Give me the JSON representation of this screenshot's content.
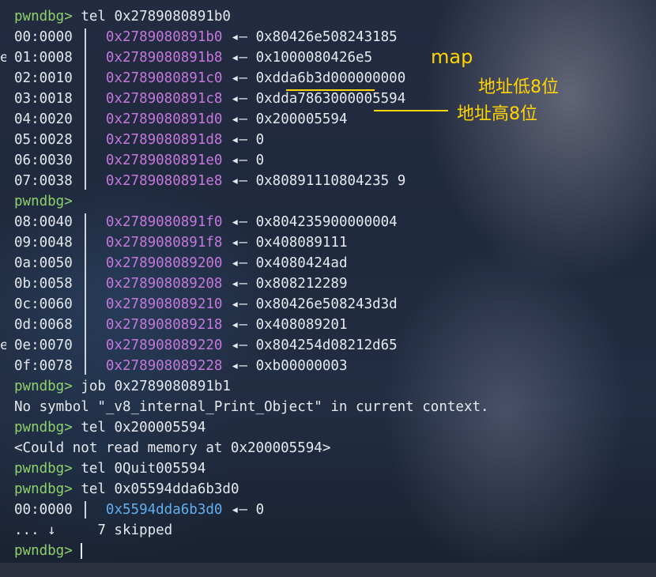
{
  "prompt": "pwndbg>",
  "commands": {
    "tel1": "tel 0x2789080891b0",
    "job": "job 0x2789080891b1",
    "tel2": "tel 0x200005594",
    "tel3": "tel 0Quit005594",
    "tel4": "tel 0x05594dda6b3d0"
  },
  "rows": [
    {
      "idx": "00:0000",
      "addr": "0x2789080891b0",
      "val": "0x80426e508243185"
    },
    {
      "idx": "01:0008",
      "addr": "0x2789080891b8",
      "val": "0x1000080426e5"
    },
    {
      "idx": "02:0010",
      "addr": "0x2789080891c0",
      "val": "0xdda6b3d000000000"
    },
    {
      "idx": "03:0018",
      "addr": "0x2789080891c8",
      "val": "0xdda7863000005594"
    },
    {
      "idx": "04:0020",
      "addr": "0x2789080891d0",
      "val": "0x200005594"
    },
    {
      "idx": "05:0028",
      "addr": "0x2789080891d8",
      "val": "0"
    },
    {
      "idx": "06:0030",
      "addr": "0x2789080891e0",
      "val": "0"
    },
    {
      "idx": "07:0038",
      "addr": "0x2789080891e8",
      "val": "0x80891110804235 9"
    }
  ],
  "rows2": [
    {
      "idx": "08:0040",
      "addr": "0x2789080891f0",
      "val": "0x804235900000004"
    },
    {
      "idx": "09:0048",
      "addr": "0x2789080891f8",
      "val": "0x408089111"
    },
    {
      "idx": "0a:0050",
      "addr": "0x278908089200",
      "val": "0x4080424ad"
    },
    {
      "idx": "0b:0058",
      "addr": "0x278908089208",
      "val": "0x808212289"
    },
    {
      "idx": "0c:0060",
      "addr": "0x278908089210",
      "val": "0x80426e508243d3d"
    },
    {
      "idx": "0d:0068",
      "addr": "0x278908089218",
      "val": "0x408089201"
    },
    {
      "idx": "0e:0070",
      "addr": "0x278908089220",
      "val": "0x804254d08212d65"
    },
    {
      "idx": "0f:0078",
      "addr": "0x278908089228",
      "val": "0xb00000003"
    }
  ],
  "arrow": "◂—",
  "messages": {
    "no_symbol": "No symbol \"_v8_internal_Print_Object\" in current context.",
    "cannot_read": "<Could not read memory at 0x200005594>"
  },
  "last_row": {
    "idx": "00:0000",
    "addr": "0x5594dda6b3d0",
    "val": "0"
  },
  "skipped": "... ↓     7 skipped",
  "edge_char": "e",
  "annotations": {
    "map": "map",
    "low8": "地址低8位",
    "high8": "地址高8位"
  },
  "colors": {
    "prompt": "#8fd16b",
    "address": "#c678dd",
    "address_blue": "#61afef",
    "annotation": "#ffd400"
  }
}
